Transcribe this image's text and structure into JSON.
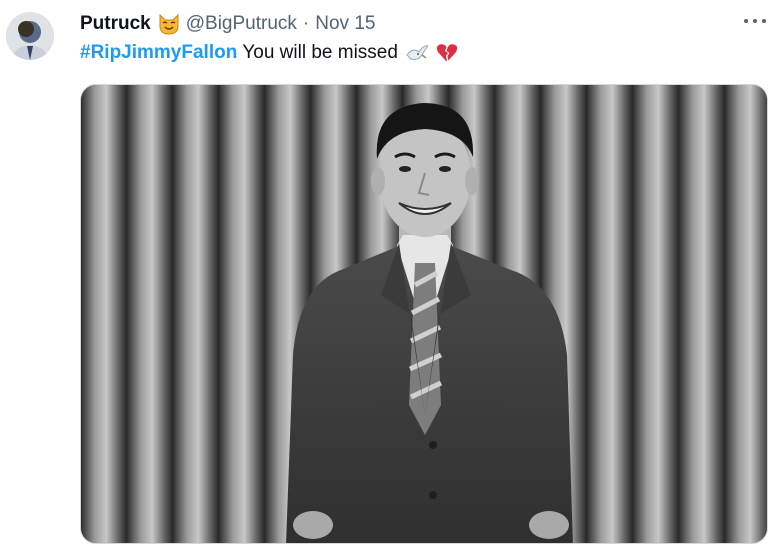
{
  "tweet": {
    "author": {
      "display_name": "Putruck",
      "name_emoji": "smiling-cat-emoji",
      "handle": "@BigPutruck",
      "avatar": "user-avatar"
    },
    "separator": "·",
    "timestamp": "Nov 15",
    "text": {
      "hashtag": "#RipJimmyFallon",
      "body": "You will be missed",
      "emojis": [
        "dove-emoji",
        "broken-heart-emoji"
      ]
    },
    "media": {
      "type": "photo",
      "description_icon": "black-and-white-photo"
    },
    "colors": {
      "hashtag": "#1d9bf0",
      "secondary_text": "#536471",
      "primary_text": "#0f1419"
    }
  }
}
